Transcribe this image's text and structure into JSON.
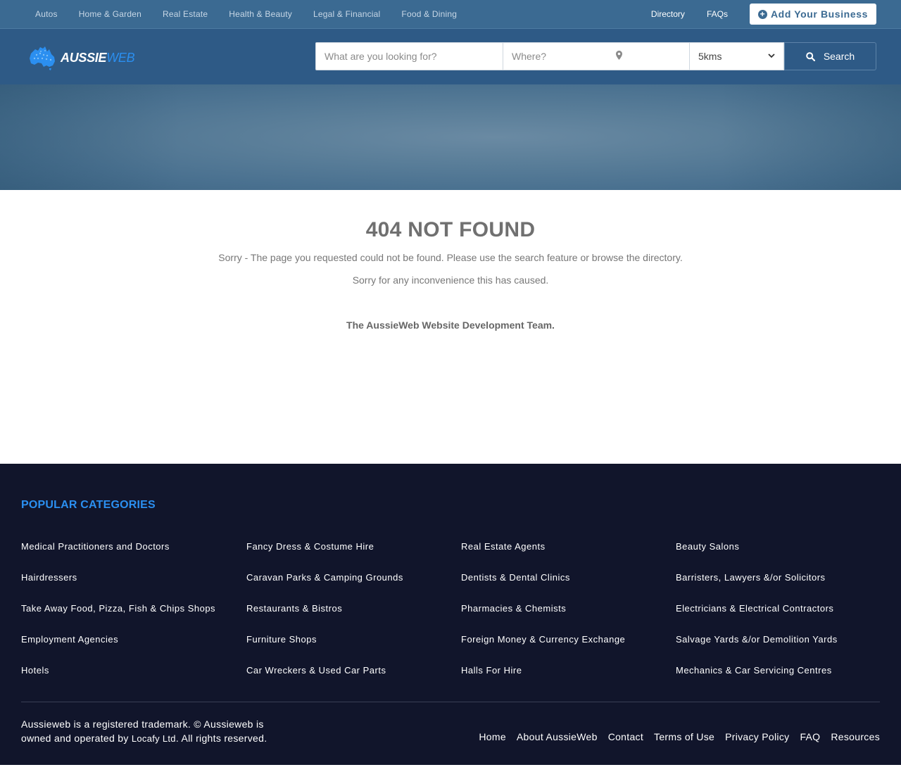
{
  "topbar": {
    "categories": [
      "Autos",
      "Home & Garden",
      "Real Estate",
      "Health & Beauty",
      "Legal & Financial",
      "Food & Dining"
    ],
    "directory": "Directory",
    "faqs": "FAQs",
    "add_business": "Add Your Business"
  },
  "logo": {
    "part1": "AUSSIE",
    "part2": "WEB"
  },
  "search": {
    "what_placeholder": "What are you looking for?",
    "where_placeholder": "Where?",
    "distance": "5kms",
    "button": "Search"
  },
  "main": {
    "title": "404 NOT FOUND",
    "message1": "Sorry - The page you requested could not be found. Please use the search feature or browse the directory.",
    "message2": "Sorry for any inconvenience this has caused.",
    "signature": "The AussieWeb Website Development Team."
  },
  "footer": {
    "heading": "POPULAR CATEGORIES",
    "columns": [
      [
        "Medical Practitioners and Doctors",
        "Hairdressers",
        "Take Away Food, Pizza, Fish & Chips Shops",
        "Employment Agencies",
        "Hotels"
      ],
      [
        "Fancy Dress & Costume Hire",
        "Caravan Parks & Camping Grounds",
        "Restaurants & Bistros",
        "Furniture Shops",
        "Car Wreckers & Used Car Parts"
      ],
      [
        "Real Estate Agents",
        "Dentists & Dental Clinics",
        "Pharmacies & Chemists",
        "Foreign Money & Currency Exchange",
        "Halls For Hire"
      ],
      [
        "Beauty Salons",
        "Barristers, Lawyers &/or Solicitors",
        "Electricians & Electrical Contractors",
        "Salvage Yards &/or Demolition Yards",
        "Mechanics & Car Servicing Centres"
      ]
    ],
    "copyright_pre": "Aussieweb is a registered trademark. © Aussieweb is owned and operated by",
    "copyright_company": "Locafy Ltd",
    "copyright_post": ". All rights reserved.",
    "links": [
      "Home",
      "About AussieWeb",
      "Contact",
      "Terms of Use",
      "Privacy Policy",
      "FAQ",
      "Resources"
    ]
  },
  "colors": {
    "topbar": "#3b6a92",
    "header": "#2e5a86",
    "accent": "#2b8ff0",
    "footer": "#11152b"
  }
}
